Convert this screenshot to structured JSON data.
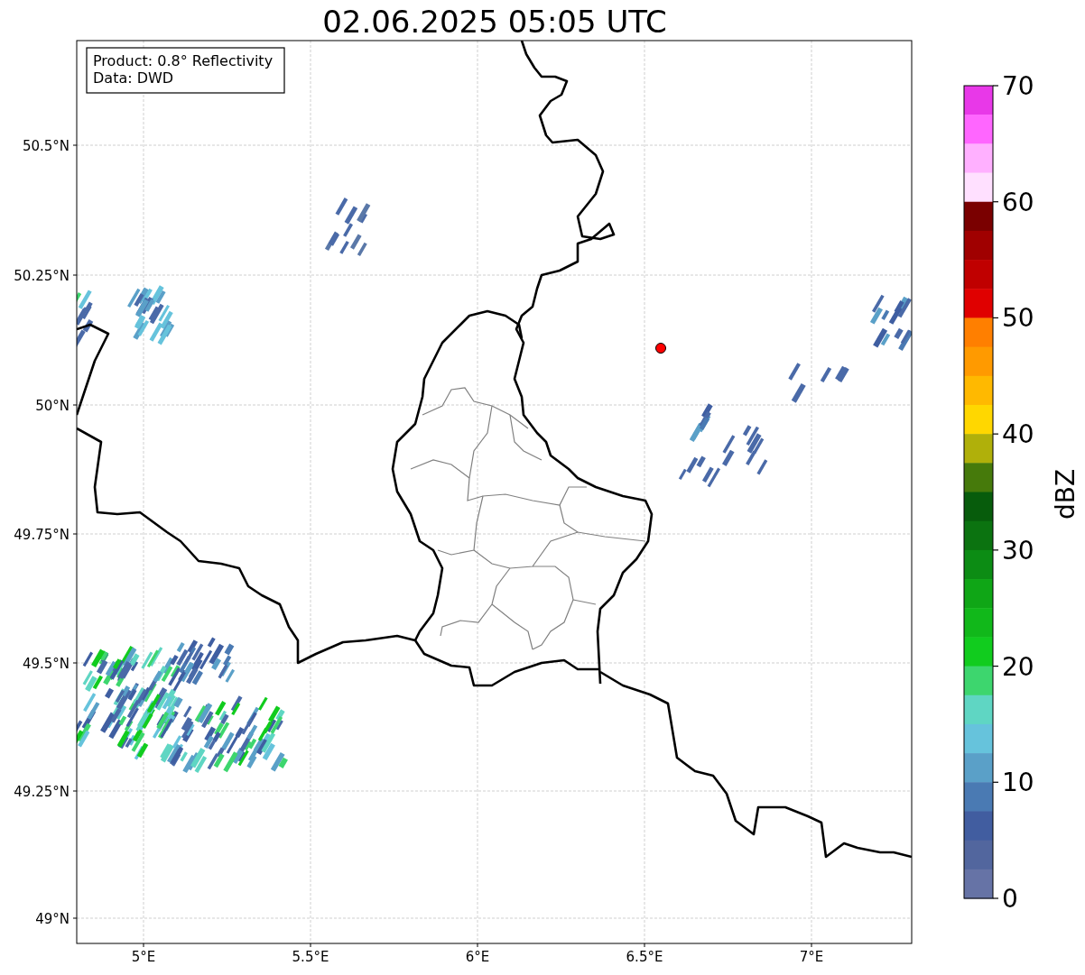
{
  "title": "02.06.2025 05:05 UTC",
  "info_box": [
    "Product: 0.8° Reflectivity",
    "Data: DWD"
  ],
  "map": {
    "xticks": [
      "5°E",
      "5.5°E",
      "6°E",
      "6.5°E",
      "7°E"
    ],
    "yticks": [
      "50.5°N",
      "50.25°N",
      "50°N",
      "49.75°N",
      "49.5°N",
      "49.25°N",
      "49°N"
    ]
  },
  "colorbar": {
    "label": "dBZ",
    "ticks": [
      "70",
      "60",
      "50",
      "40",
      "30",
      "20",
      "10",
      "0"
    ],
    "bands": [
      {
        "color": "#e838e8"
      },
      {
        "color": "#ff66ff"
      },
      {
        "color": "#ffb0ff"
      },
      {
        "color": "#ffe0ff"
      },
      {
        "color": "#7a0000"
      },
      {
        "color": "#a00000"
      },
      {
        "color": "#c00000"
      },
      {
        "color": "#e00000"
      },
      {
        "color": "#ff7f00"
      },
      {
        "color": "#ff9a00"
      },
      {
        "color": "#ffb900"
      },
      {
        "color": "#ffd700"
      },
      {
        "color": "#b0b00a"
      },
      {
        "color": "#467a0b"
      },
      {
        "color": "#075c0c"
      },
      {
        "color": "#0b7310"
      },
      {
        "color": "#0c8c14"
      },
      {
        "color": "#0fa616"
      },
      {
        "color": "#11b81a"
      },
      {
        "color": "#11cc1e"
      },
      {
        "color": "#3dd66e"
      },
      {
        "color": "#5fd6c3"
      },
      {
        "color": "#66c3dc"
      },
      {
        "color": "#5aa0c8"
      },
      {
        "color": "#4a7ab3"
      },
      {
        "color": "#415da0"
      },
      {
        "color": "#52669e"
      },
      {
        "color": "#6673a6"
      }
    ]
  }
}
